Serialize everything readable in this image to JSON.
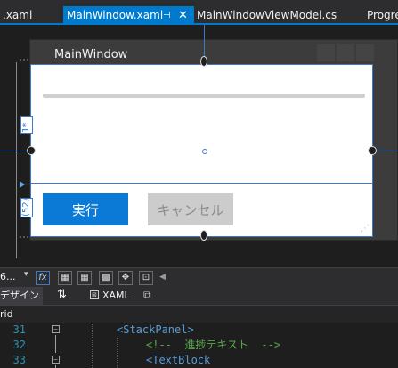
{
  "tabs": {
    "xaml_partial": ".xaml",
    "active": "MainWindow.xaml",
    "pin_icon": "⊣",
    "close_icon": "✕",
    "viewmodel": "MainWindowViewModel.cs",
    "progress_partial": "Progre"
  },
  "designer": {
    "window_title": "MainWindow",
    "progress_value": 0,
    "execute_button": "実行",
    "cancel_button": "キャンセル",
    "row_label_star": "1*",
    "row_label_height": "(52)"
  },
  "toolbar": {
    "zoom": "6...",
    "fx_label": "fx"
  },
  "view_switch": {
    "design_label": "デザイン",
    "swap_icon": "⇅",
    "xaml_label": "XAML"
  },
  "breadcrumb": {
    "item": "rid"
  },
  "editor": {
    "lines": [
      {
        "number": "31",
        "text": "<StackPanel>"
      },
      {
        "number": "32",
        "text": "<!--  進捗テキスト  -->"
      },
      {
        "number": "33",
        "text": "<TextBlock"
      }
    ]
  },
  "colors": {
    "accent": "#007acc",
    "execute_bg": "#0a7ad6",
    "cancel_bg": "#cccccc",
    "selection": "#3a79c6"
  }
}
